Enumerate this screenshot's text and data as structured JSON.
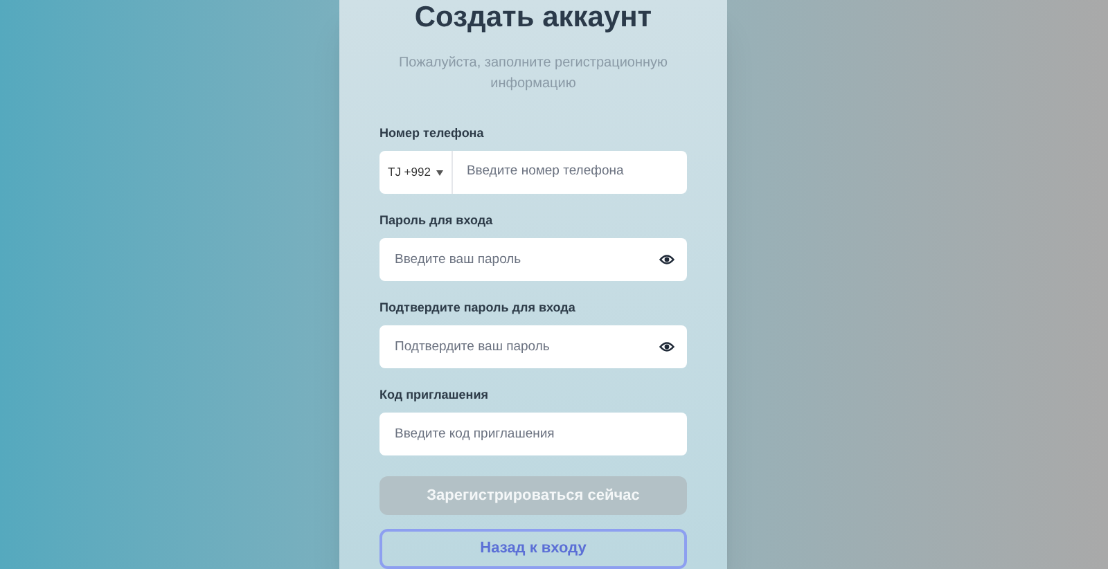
{
  "title": "Создать аккаунт",
  "subtitle": "Пожалуйста, заполните регистрационную информацию",
  "fields": [
    {
      "kind": "phone",
      "label": "Номер телефона",
      "country": "TJ +992",
      "placeholder": "Введите номер телефона"
    },
    {
      "kind": "password",
      "label": "Пароль для входа",
      "placeholder": "Введите ваш пароль"
    },
    {
      "kind": "password",
      "label": "Подтвердите пароль для входа",
      "placeholder": "Подтвердите ваш пароль"
    },
    {
      "kind": "text",
      "label": "Код приглашения",
      "placeholder": "Введите код приглашения"
    }
  ],
  "register_button": {
    "label": "Зарегистрироваться сейчас",
    "disabled": true
  },
  "back_button": {
    "label": "Назад к входу"
  }
}
